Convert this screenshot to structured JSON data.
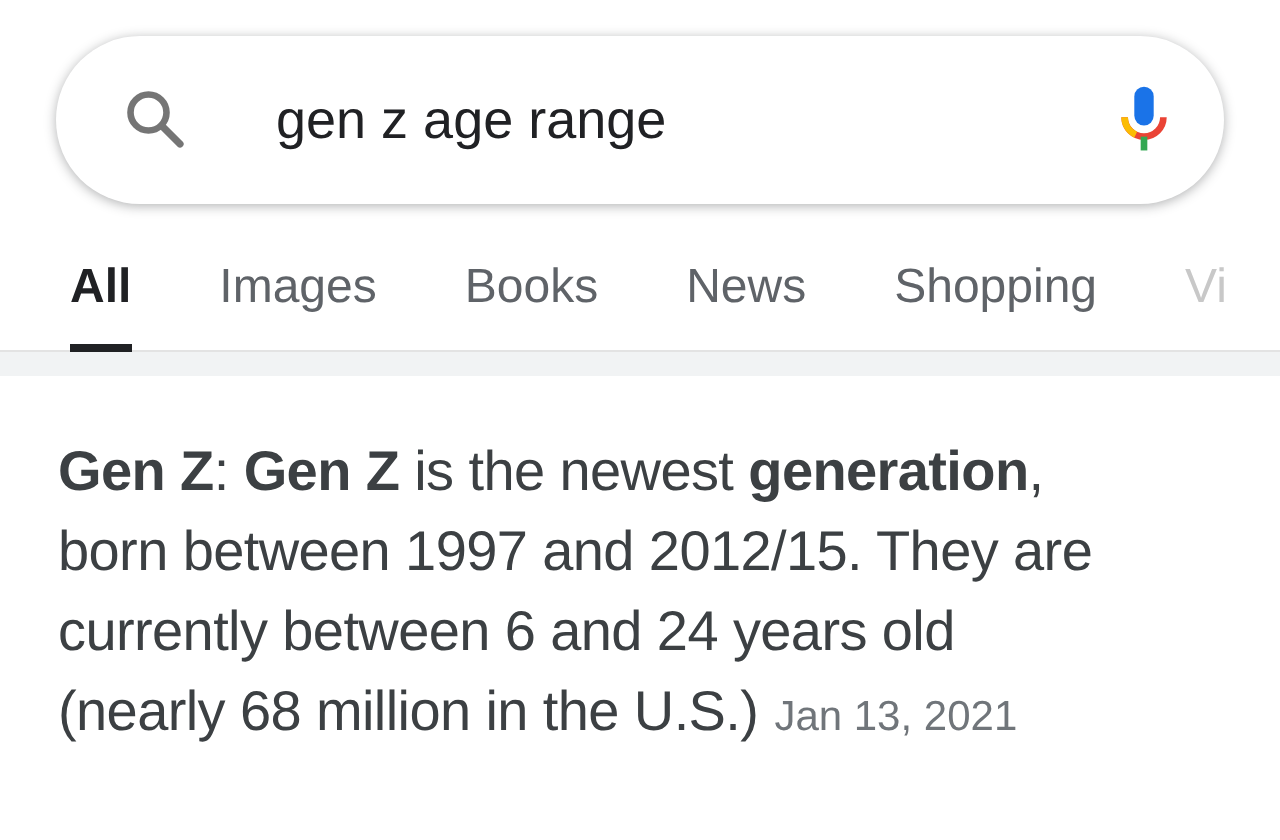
{
  "search": {
    "value": "gen z age range"
  },
  "tabs": [
    {
      "label": "All",
      "selected": true
    },
    {
      "label": "Images",
      "selected": false
    },
    {
      "label": "Books",
      "selected": false
    },
    {
      "label": "News",
      "selected": false
    },
    {
      "label": "Shopping",
      "selected": false
    },
    {
      "label": "Vi",
      "selected": false
    }
  ],
  "snippet": {
    "text": "**Gen Z**: **Gen Z** is the newest **generation**, born between 1997 and 2012/15. They are currently between 6 and 24 years old (nearly 68 million in the U.S.)",
    "date": "Jan 13, 2021"
  }
}
